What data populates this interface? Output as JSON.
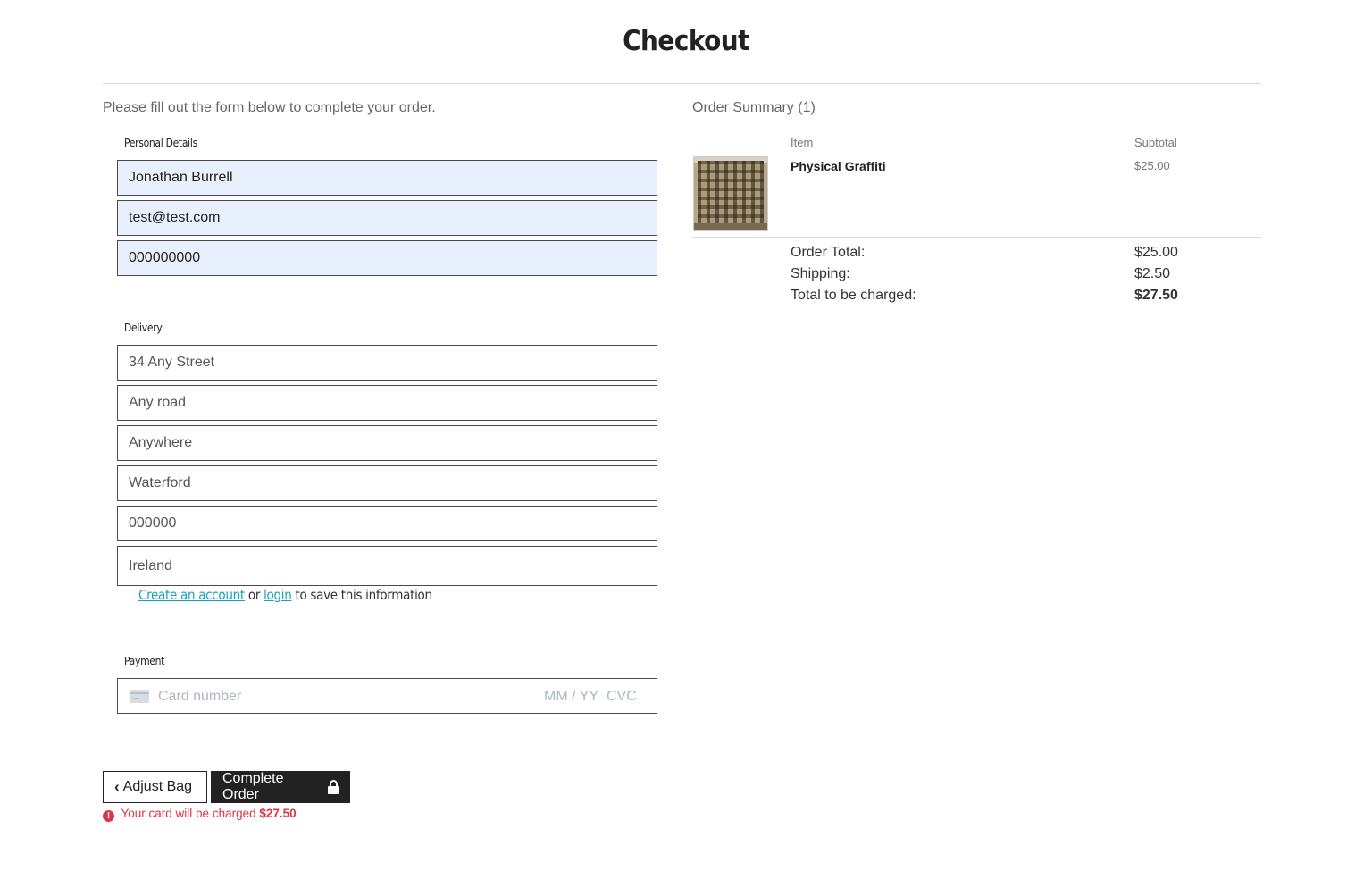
{
  "header": {
    "title": "Checkout"
  },
  "form": {
    "intro": "Please fill out the form below to complete your order.",
    "personal": {
      "legend": "Personal Details",
      "full_name": "Jonathan Burrell",
      "email": "test@test.com",
      "phone": "000000000"
    },
    "delivery": {
      "legend": "Delivery",
      "street1": "34 Any Street",
      "street2": "Any road",
      "town": "Anywhere",
      "county": "Waterford",
      "postcode": "000000",
      "country": "Ireland",
      "save": {
        "create_account": "Create an account",
        "or": "or",
        "login": "login",
        "suffix": "to save this information"
      }
    },
    "payment": {
      "legend": "Payment",
      "card_placeholder": "Card number",
      "expiry_placeholder": "MM / YY",
      "cvc_placeholder": "CVC"
    },
    "buttons": {
      "adjust": "Adjust Bag",
      "complete": "Complete Order"
    },
    "charge_note": {
      "prefix": "Your card will be charged",
      "amount": "$27.50"
    }
  },
  "summary": {
    "title": "Order Summary (1)",
    "headers": {
      "item": "Item",
      "subtotal": "Subtotal"
    },
    "items": [
      {
        "name": "Physical Graffiti",
        "price": "$25.00"
      }
    ],
    "totals": {
      "order_total_label": "Order Total:",
      "order_total": "$25.00",
      "shipping_label": "Shipping:",
      "shipping": "$2.50",
      "grand_total_label": "Total to be charged:",
      "grand_total": "$27.50"
    }
  },
  "colors": {
    "accent_link": "#17a2b8",
    "danger": "#dc3545",
    "autofill": "#e8f0fe",
    "dark": "#222222"
  },
  "icons": [
    "chevron-left-icon",
    "lock-icon",
    "exclamation-circle-icon",
    "credit-card-icon"
  ]
}
